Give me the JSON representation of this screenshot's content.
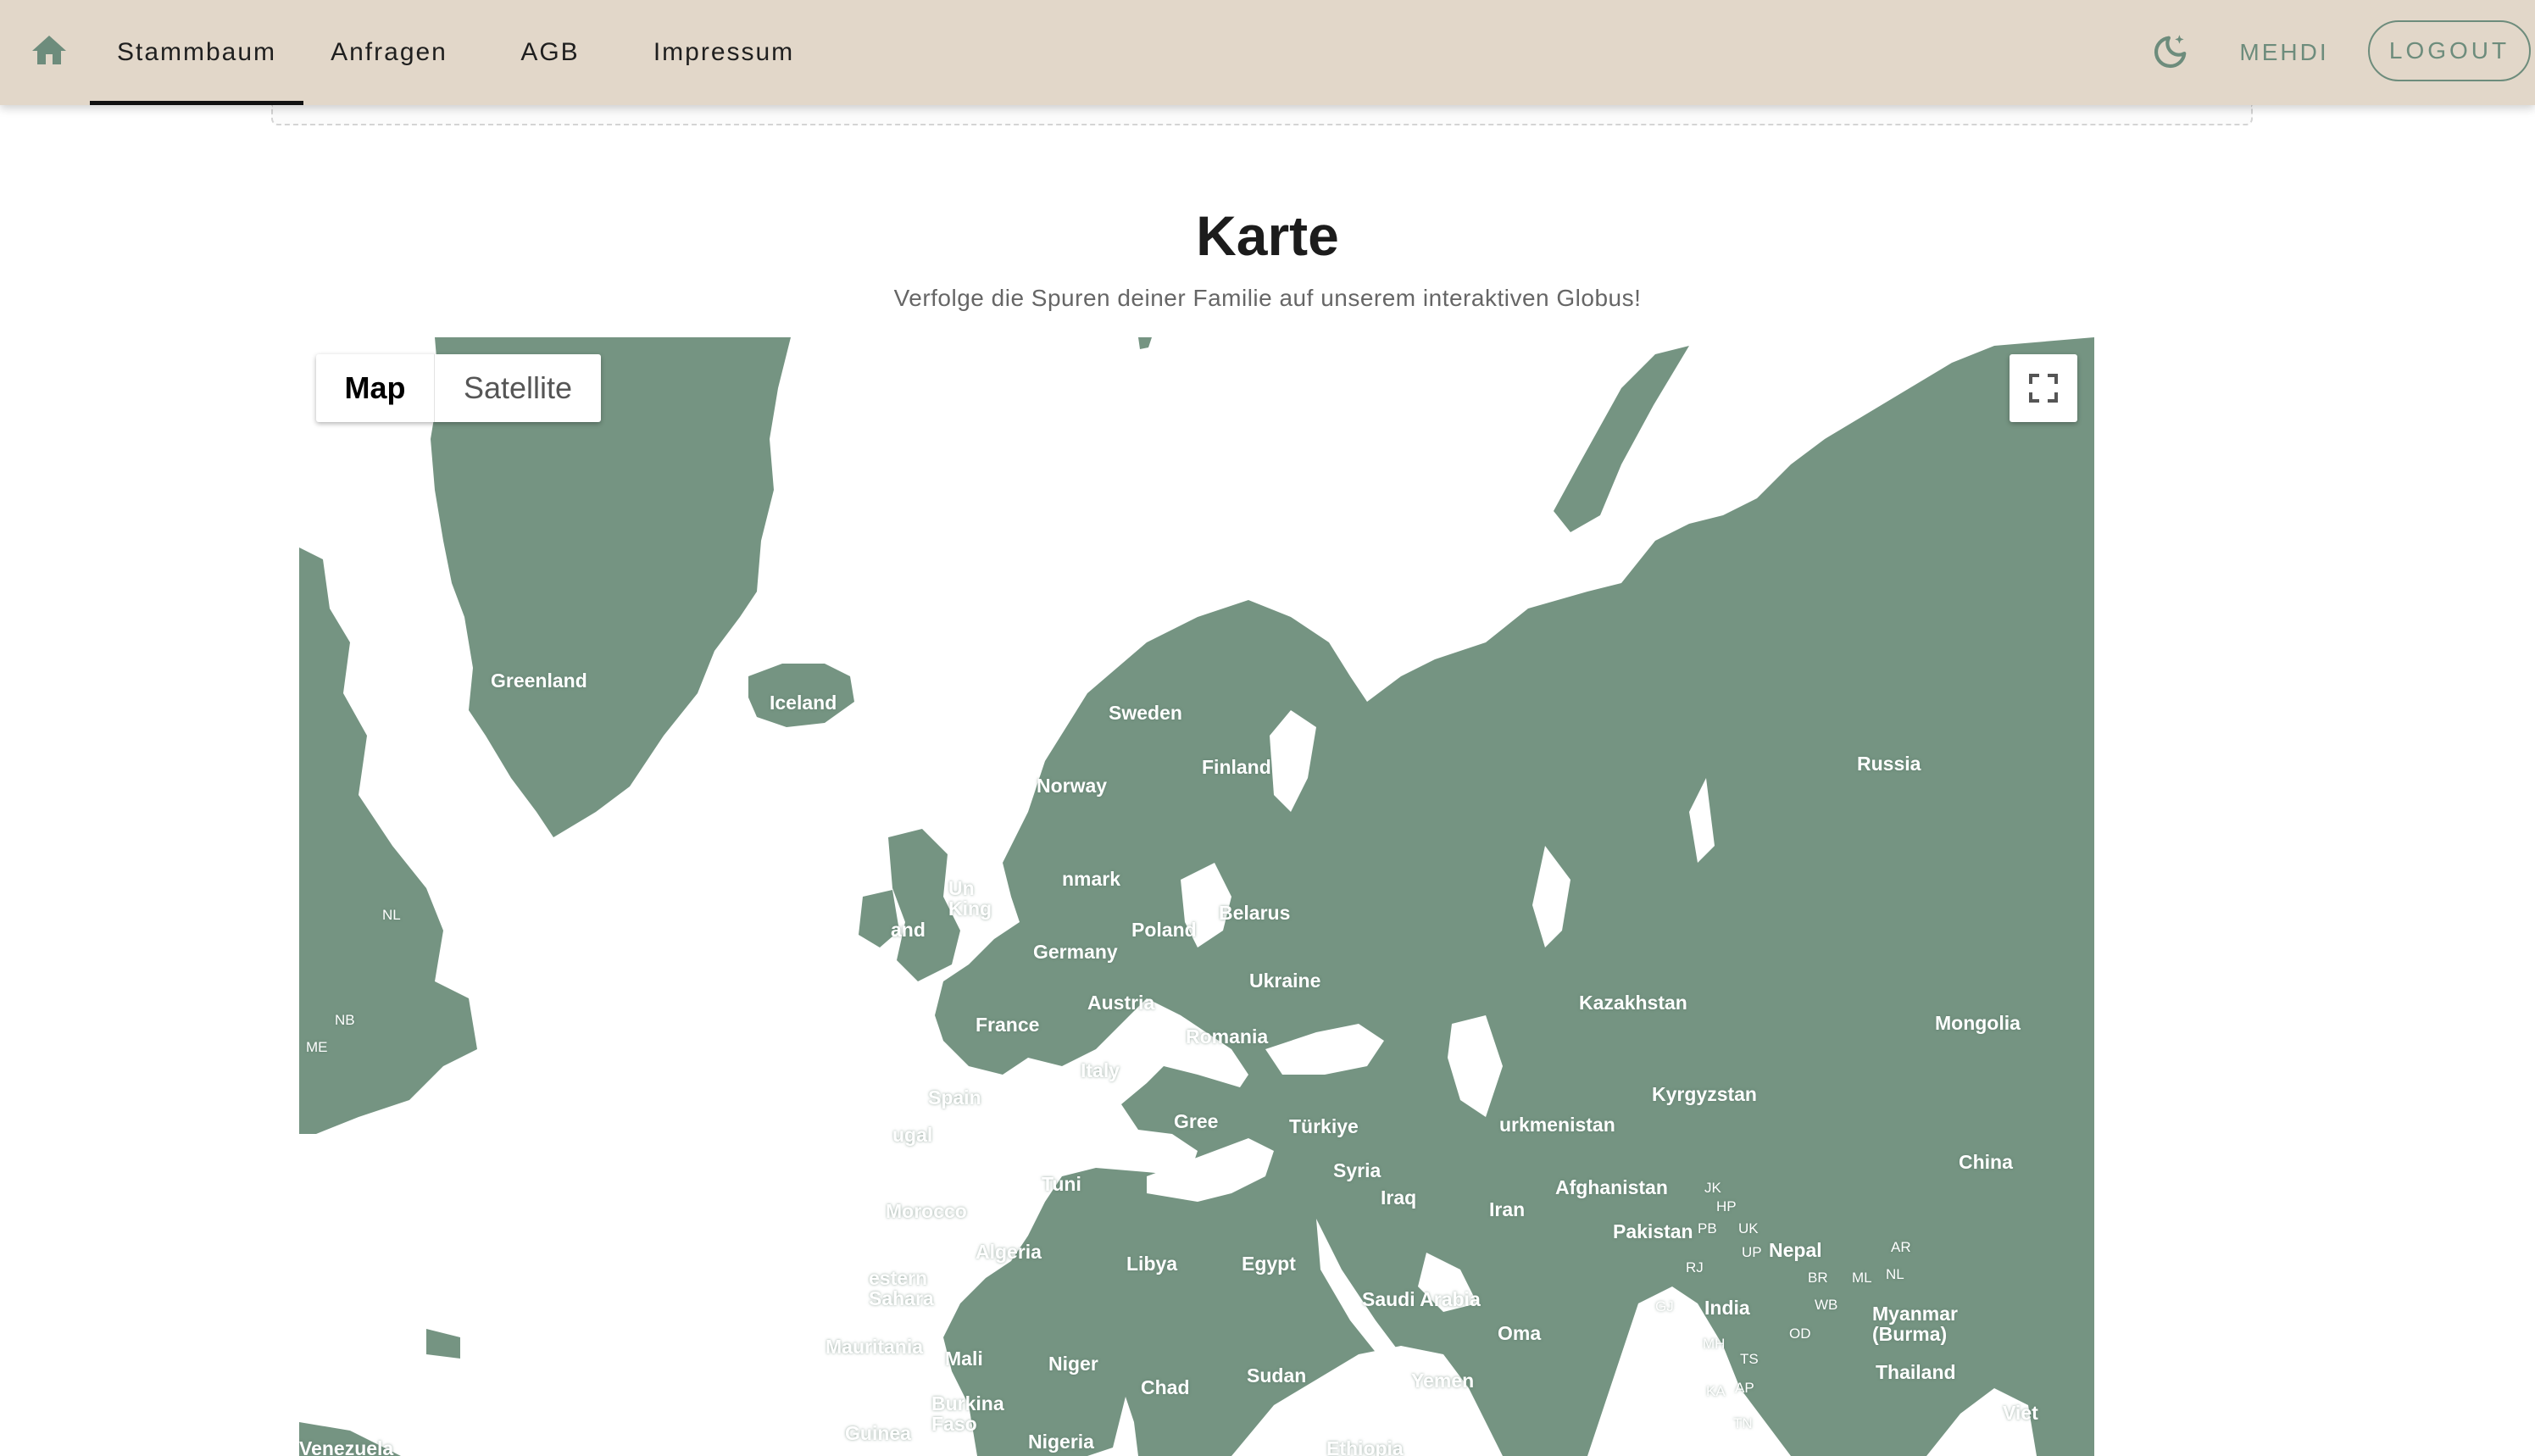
{
  "nav": {
    "tabs": [
      {
        "label": "Stammbaum",
        "active": true
      },
      {
        "label": "Anfragen",
        "active": false
      },
      {
        "label": "AGB",
        "active": false
      },
      {
        "label": "Impressum",
        "active": false
      }
    ],
    "home_icon": "home-icon",
    "theme_icon": "theme-toggle-icon",
    "user": "MEHDI",
    "logout_label": "LOGOUT"
  },
  "colors": {
    "appbar_bg": "#e2d7c9",
    "accent": "#6d8c7c",
    "land": "#759482"
  },
  "page": {
    "title": "Karte",
    "subtitle": "Verfolge die Spuren deiner Familie auf unserem interaktiven Globus!"
  },
  "map": {
    "type_options": {
      "map": "Map",
      "satellite": "Satellite"
    },
    "selected_type": "Map",
    "fullscreen_icon": "fullscreen-icon",
    "labels": {
      "greenland": "Greenland",
      "iceland": "Iceland",
      "sweden": "Sweden",
      "finland": "Finland",
      "norway": "Norway",
      "russia": "Russia",
      "uk": "Un\nKing",
      "ireland": "and",
      "denmark": "nmark",
      "belarus": "Belarus",
      "poland": "Poland",
      "germany": "Germany",
      "ukraine": "Ukraine",
      "france": "France",
      "austria": "Austria",
      "kazakhstan": "Kazakhstan",
      "mongolia": "Mongolia",
      "romania": "Romania",
      "italy": "Italy",
      "kyrgyzstan": "Kyrgyzstan",
      "spain": "Spain",
      "portugal": "ugal",
      "greece": "Gree",
      "turkiye": "Türkiye",
      "turkmenistan": "urkmenistan",
      "syria": "Syria",
      "china": "China",
      "tunisia": "Tuni",
      "iraq": "Iraq",
      "afghanistan": "Afghanistan",
      "iran": "Iran",
      "morocco": "Morocco",
      "pakistan": "Pakistan",
      "algeria": "Algeria",
      "libya": "Libya",
      "egypt": "Egypt",
      "nepal": "Nepal",
      "western_sahara": "estern\nSahara",
      "saudi_arabia": "Saudi Arabia",
      "india": "India",
      "myanmar": "Myanmar\n(Burma)",
      "oman": "Oma",
      "mauritania": "Mauritania",
      "mali": "Mali",
      "niger": "Niger",
      "sudan": "Sudan",
      "chad": "Chad",
      "yemen": "Yemen",
      "thailand": "Thailand",
      "burkina_faso": "Burkina\nFaso",
      "guinea": "Guinea",
      "nigeria": "Nigeria",
      "ethiopia": "Ethiopia",
      "vietnam": "Viet",
      "venezuela": "Venezuela",
      "nl": "NL",
      "nb": "NB",
      "me": "ME",
      "jk": "JK",
      "hp": "HP",
      "pb": "PB",
      "uk_state": "UK",
      "rj": "RJ",
      "up": "UP",
      "ar": "AR",
      "br": "BR",
      "ml": "ML",
      "nl_in": "NL",
      "wb": "WB",
      "gj": "GJ",
      "mh": "MH",
      "od": "OD",
      "ts": "TS",
      "ka": "KA",
      "ap": "AP",
      "tn": "TN"
    }
  }
}
